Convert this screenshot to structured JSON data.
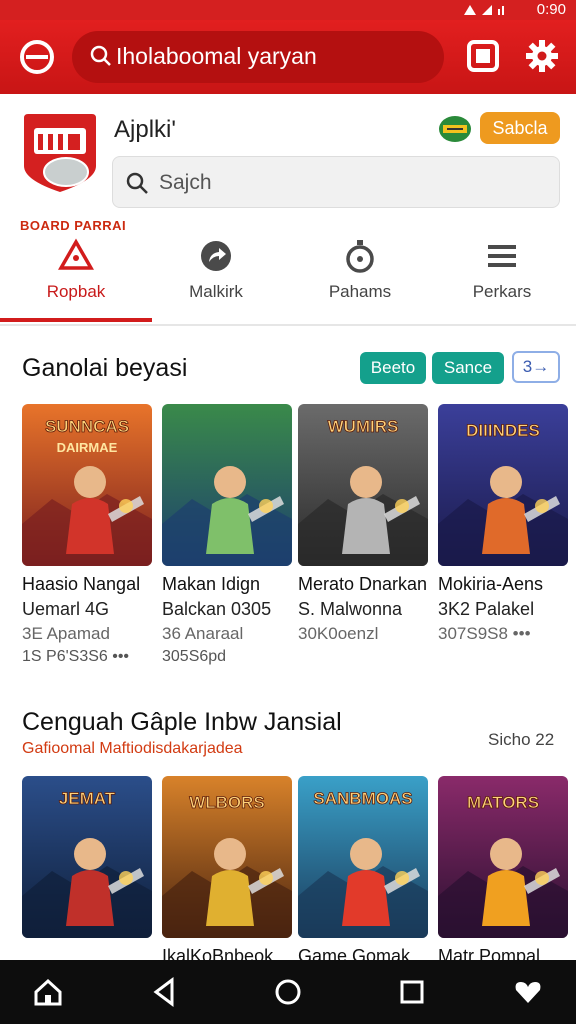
{
  "status_bar": {
    "time": "0:90"
  },
  "top_bar": {
    "search_text": "Iholaboomal yaryan"
  },
  "header": {
    "title": "Ajplki'",
    "action_button": "Sabcla",
    "search_placeholder": "Sajch",
    "brand_text": "BOARD PARRAI"
  },
  "tabs": [
    {
      "label": "Ropbak",
      "icon": "warning-triangle-icon",
      "active": true
    },
    {
      "label": "Malkirk",
      "icon": "share-arrow-icon",
      "active": false
    },
    {
      "label": "Pahams",
      "icon": "stopwatch-icon",
      "active": false
    },
    {
      "label": "Perkars",
      "icon": "menu-icon",
      "active": false
    }
  ],
  "section1": {
    "title": "Ganolai beyasi",
    "chips": [
      "Beeto",
      "Sance",
      "3→"
    ],
    "cards": [
      {
        "line1": "Haasio Nangal",
        "line2": "Uemarl 4G",
        "line3": "3E Apamad",
        "line4": "1S P6'S3S6 •••",
        "palette": [
          "#e8742a",
          "#7a1f1f",
          "#d2342a"
        ],
        "art_text": "SUNNCAS DAIRMAE"
      },
      {
        "line1": "Makan Idign",
        "line2": "Balckan 0305",
        "line3": "36 Anaraal",
        "line4": "305S6pd",
        "palette": [
          "#3a8a4a",
          "#1d3f6e",
          "#7fc06a"
        ],
        "art_text": ""
      },
      {
        "line1": "Merato Dnarkan",
        "line2": "S. Malwonna",
        "line3": "30K0oenzl",
        "line4": "",
        "palette": [
          "#6b6b6b",
          "#2a2a2a",
          "#b4b4b4"
        ],
        "art_text": "WUMIRS"
      },
      {
        "line1": "Mokiria-Aens",
        "line2": "3K2 Palakel",
        "line3": "307S9S8 •••",
        "line4": "",
        "palette": [
          "#3b3f9a",
          "#1a1a4a",
          "#e06a2a"
        ],
        "art_text": "DIIINDES"
      }
    ]
  },
  "section2": {
    "title": "Cenguah Gâple Inbw Jansial",
    "subtitle": "Gafioomal Maftiodisdakarjadea",
    "see_more": "Sicho 22",
    "cards": [
      {
        "line1": "",
        "palette": [
          "#2b4e8a",
          "#0f1f3a",
          "#c0302a"
        ],
        "art_text": "JEMAT"
      },
      {
        "line1": "IkalKoBnbeok",
        "palette": [
          "#d8822a",
          "#4a2410",
          "#e0b030"
        ],
        "art_text": "WLBORS"
      },
      {
        "line1": "Game Gomak",
        "palette": [
          "#3aa0c8",
          "#1a3a5a",
          "#e23a2a"
        ],
        "art_text": "SANBMOAS"
      },
      {
        "line1": "Matr Pompal",
        "palette": [
          "#8a2a6a",
          "#2a1030",
          "#f0a020"
        ],
        "art_text": "MATORS"
      }
    ]
  }
}
